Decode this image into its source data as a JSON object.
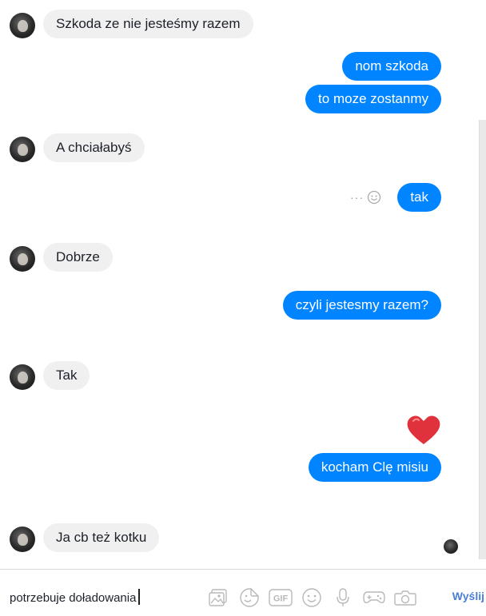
{
  "messages": [
    {
      "side": "in",
      "text": "Szkoda ze nie jesteśmy razem"
    },
    {
      "side": "out",
      "text": "nom szkoda"
    },
    {
      "side": "out",
      "text": "to moze zostanmy"
    },
    {
      "side": "in",
      "text": "A chciałabyś"
    },
    {
      "side": "out",
      "text": "tak"
    },
    {
      "side": "in",
      "text": "Dobrze"
    },
    {
      "side": "out",
      "text": "czyli jestesmy razem?"
    },
    {
      "side": "in",
      "text": "Tak"
    },
    {
      "side": "out",
      "text": "kocham Clę misiu"
    },
    {
      "side": "in",
      "text": "Ja cb też kotku"
    }
  ],
  "reaction": {
    "heart_color": "#e0323d"
  },
  "composer": {
    "input_value": "potrzebuje doładowania",
    "send_label": "Wyślij"
  },
  "colors": {
    "outgoing": "#0084ff",
    "incoming": "#f1f0f0",
    "accent": "#4a7fd4"
  },
  "icons": [
    "more-icon",
    "emoji-react-icon",
    "photo-icon",
    "sticker-icon",
    "gif-icon",
    "emoji-icon",
    "microphone-icon",
    "game-icon",
    "camera-icon"
  ]
}
